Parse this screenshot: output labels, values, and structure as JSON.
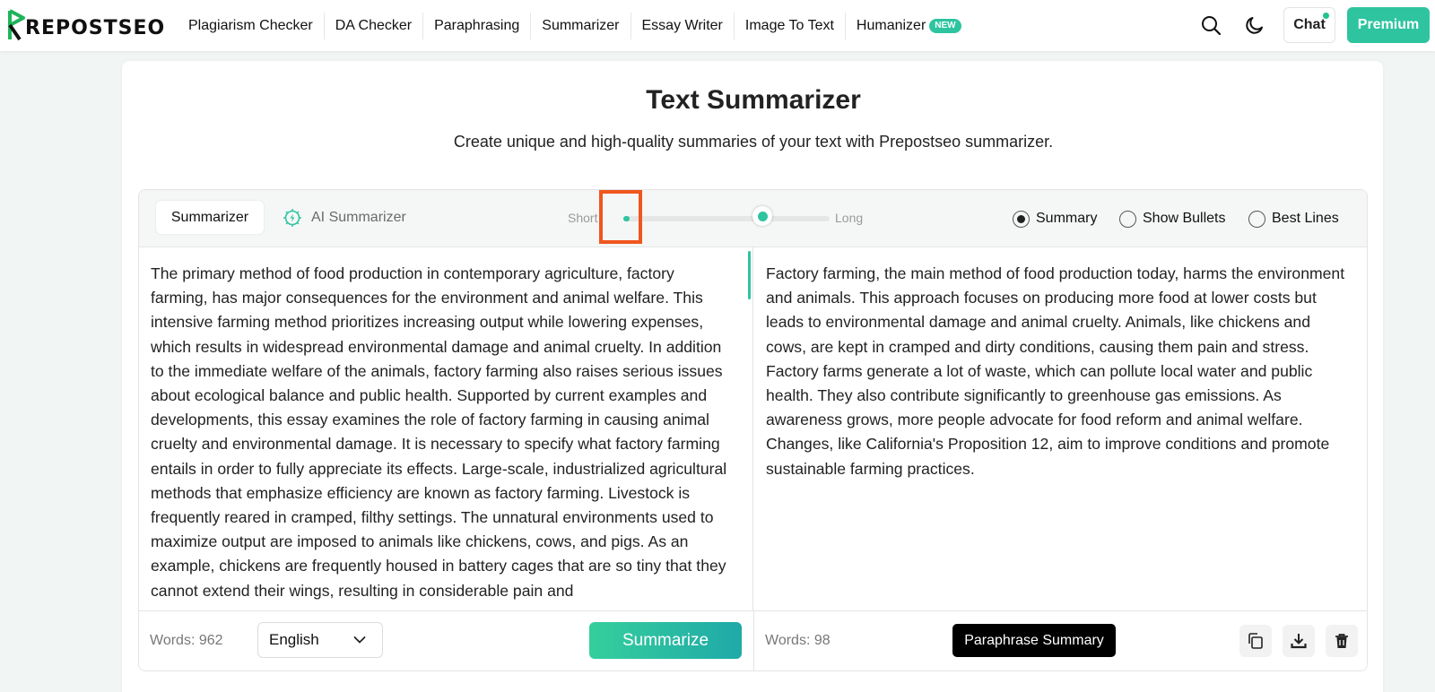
{
  "brand": {
    "logo_text": "REPOSTSEO"
  },
  "nav": {
    "items": [
      {
        "label": "Plagiarism Checker"
      },
      {
        "label": "DA Checker"
      },
      {
        "label": "Paraphrasing"
      },
      {
        "label": "Summarizer"
      },
      {
        "label": "Essay Writer"
      },
      {
        "label": "Image To Text"
      },
      {
        "label": "Humanizer",
        "badge": "NEW"
      }
    ],
    "chat_label": "Chat",
    "premium_label": "Premium",
    "icons": [
      "search-icon",
      "moon-icon"
    ]
  },
  "page": {
    "title": "Text Summarizer",
    "subtitle": "Create unique and high-quality summaries of your text with Prepostseo summarizer."
  },
  "toolbar": {
    "tabs": [
      {
        "label": "Summarizer",
        "active": true
      },
      {
        "label": "AI Summarizer",
        "active": false,
        "icon": "ai-chip-icon"
      }
    ],
    "slider": {
      "min_label": "Short",
      "max_label": "Long",
      "value": 0.03
    },
    "modes": [
      {
        "label": "Summary",
        "selected": true
      },
      {
        "label": "Show Bullets",
        "selected": false
      },
      {
        "label": "Best Lines",
        "selected": false
      }
    ]
  },
  "input": {
    "text": "The primary method of food production in contemporary agriculture, factory farming, has major consequences for the environment and animal welfare. This intensive farming method prioritizes increasing output while lowering expenses, which results in widespread environmental damage and animal cruelty. In addition to the immediate welfare of the animals, factory farming also raises serious issues about ecological balance and public health. Supported by current examples and developments, this essay examines the role of factory farming in causing animal cruelty and environmental damage. It is necessary to specify what factory farming entails in order to fully appreciate its effects. Large-scale, industrialized agricultural methods that emphasize efficiency are known as factory farming. Livestock is frequently reared in cramped, filthy settings. The unnatural environments used to maximize output are imposed to animals like chickens, cows, and pigs. As an example, chickens are frequently housed in battery cages that are so tiny that they cannot extend their wings, resulting in considerable pain and",
    "word_count": "Words: 962",
    "language": "English",
    "summarize_label": "Summarize"
  },
  "output": {
    "text": "Factory farming, the main method of food production today, harms the environment and animals. This approach focuses on producing more food at lower costs but leads to environmental damage and animal cruelty. Animals, like chickens and cows, are kept in cramped and dirty conditions, causing them pain and stress. Factory farms generate a lot of waste, which can pollute local water and public health. They also contribute significantly to greenhouse gas emissions. As awareness grows, more people advocate for food reform and animal welfare. Changes, like California's Proposition 12, aim to improve conditions and promote sustainable farming practices.",
    "word_count": "Words: 98",
    "paraphrase_label": "Paraphrase Summary",
    "actions": [
      "copy-icon",
      "download-icon",
      "trash-icon"
    ]
  },
  "colors": {
    "accent": "#2ec4a0",
    "highlight": "#f0561d"
  }
}
